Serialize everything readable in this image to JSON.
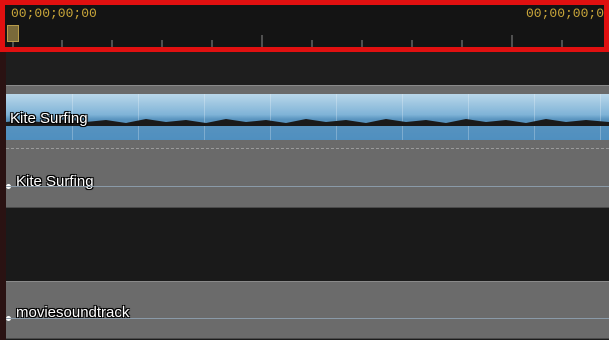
{
  "timeline": {
    "start_timecode": "00;00;00;00",
    "end_timecode": "00;00;00;0",
    "highlight_color": "#e01010",
    "timecode_color": "#c9a63a"
  },
  "tracks": {
    "video": {
      "clip_label": "Kite Surfing"
    },
    "video_audio": {
      "clip_label": "Kite Surfing"
    },
    "music": {
      "clip_label": "moviesoundtrack"
    }
  }
}
